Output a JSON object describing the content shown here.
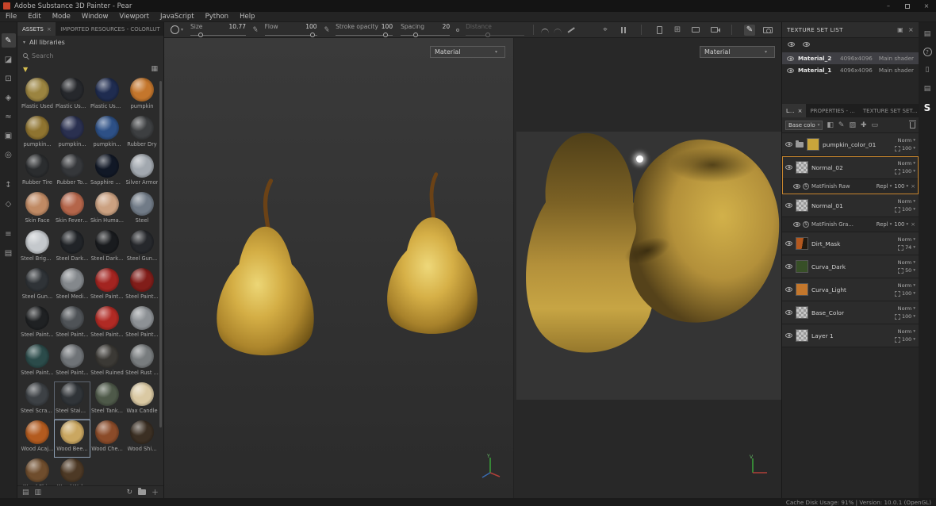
{
  "titlebar": {
    "title": "Adobe Substance 3D Painter - Pear"
  },
  "menubar": {
    "items": [
      "File",
      "Edit",
      "Mode",
      "Window",
      "Viewport",
      "JavaScript",
      "Python",
      "Help"
    ]
  },
  "toolbar": {
    "sliders": [
      {
        "label": "Size",
        "value": "10.77",
        "pct": 18
      },
      {
        "label": "Flow",
        "value": "100",
        "pct": 92
      },
      {
        "label": "Stroke opacity",
        "value": "100",
        "pct": 88
      },
      {
        "label": "Spacing",
        "value": "20",
        "pct": 30
      },
      {
        "label": "Distance",
        "value": "",
        "pct": 38,
        "disabled": true
      }
    ]
  },
  "tool_strip": {
    "groups": [
      [
        {
          "name": "paint-tool",
          "glyph": "✎",
          "active": true
        },
        {
          "name": "eraser-tool",
          "glyph": "◪"
        },
        {
          "name": "projection-tool",
          "glyph": "⊡"
        },
        {
          "name": "polygon-fill-tool",
          "glyph": "◈"
        },
        {
          "name": "smudge-tool",
          "glyph": "≈"
        },
        {
          "name": "clone-tool",
          "glyph": "▣"
        },
        {
          "name": "material-picker-tool",
          "glyph": "◎"
        }
      ],
      [
        {
          "name": "export-tool",
          "glyph": "↕"
        },
        {
          "name": "geometry-tool",
          "glyph": "◇"
        }
      ],
      [
        {
          "name": "settings-tool",
          "glyph": "≡"
        },
        {
          "name": "shelf-tool",
          "glyph": "▤"
        }
      ]
    ]
  },
  "assets_panel": {
    "tab_assets": "ASSETS",
    "tab_imported": "IMPORTED RESOURCES - COLORLUT",
    "all_libraries": "All libraries",
    "search_placeholder": "Search",
    "materials": [
      {
        "label": "Plastic Used",
        "color": "#9b8440"
      },
      {
        "label": "Plastic Use...",
        "color": "#26282c"
      },
      {
        "label": "Plastic Use...",
        "color": "#1f2c50"
      },
      {
        "label": "pumpkin",
        "color": "#c4762c"
      },
      {
        "label": "pumpkin...",
        "color": "#8f7430"
      },
      {
        "label": "pumpkin...",
        "color": "#2a3050"
      },
      {
        "label": "pumpkin...",
        "color": "#2d5086"
      },
      {
        "label": "Rubber Dry",
        "color": "#3d3f41"
      },
      {
        "label": "Rubber Tire",
        "color": "#2b2d2f"
      },
      {
        "label": "Rubber To...",
        "color": "#35373a"
      },
      {
        "label": "Sapphire C...",
        "color": "#111826"
      },
      {
        "label": "Silver Armor",
        "color": "#a2a8af"
      },
      {
        "label": "Skin Face",
        "color": "#c08a64"
      },
      {
        "label": "Skin Feverish",
        "color": "#b4654a"
      },
      {
        "label": "Skin Huma...",
        "color": "#cba181"
      },
      {
        "label": "Steel",
        "color": "#717b87"
      },
      {
        "label": "Steel Brigh...",
        "color": "#c4c8cc"
      },
      {
        "label": "Steel Dark...",
        "color": "#212428"
      },
      {
        "label": "Steel Dark...",
        "color": "#191b1e"
      },
      {
        "label": "Steel Gun...",
        "color": "#26282c"
      },
      {
        "label": "Steel Gun...",
        "color": "#2f3337"
      },
      {
        "label": "Steel Medi...",
        "color": "#84888c"
      },
      {
        "label": "Steel Painted",
        "color": "#a32420"
      },
      {
        "label": "Steel Paint...",
        "color": "#811d19"
      },
      {
        "label": "Steel Paint...",
        "color": "#1f2123"
      },
      {
        "label": "Steel Paint...",
        "color": "#4f5357"
      },
      {
        "label": "Steel Paint...",
        "color": "#b12a24"
      },
      {
        "label": "Steel Paint...",
        "color": "#8d9195"
      },
      {
        "label": "Steel Paint...",
        "color": "#2b4b4a"
      },
      {
        "label": "Steel Paint...",
        "color": "#6f7377"
      },
      {
        "label": "Steel Ruined",
        "color": "#3b3935"
      },
      {
        "label": "Steel Rust ...",
        "color": "#787c7e"
      },
      {
        "label": "Steel Scrat...",
        "color": "#3d4145"
      },
      {
        "label": "Steel Stained",
        "color": "#303438",
        "focused": true
      },
      {
        "label": "Steel Tank...",
        "color": "#4e5949"
      },
      {
        "label": "Wax Candle",
        "color": "#dac9a3"
      },
      {
        "label": "Wood Acaj...",
        "color": "#b35b1f"
      },
      {
        "label": "Wood Bee...",
        "color": "#caa761",
        "selected": true
      },
      {
        "label": "Wood Che...",
        "color": "#8b4b29"
      },
      {
        "label": "Wood Shi...",
        "color": "#3b2f23"
      },
      {
        "label": "Wood Shi...",
        "color": "#6f4d2d"
      },
      {
        "label": "Wood Wal...",
        "color": "#4d3925"
      }
    ]
  },
  "viewport3d": {
    "shading": "Material"
  },
  "viewport2d": {
    "shading": "Material"
  },
  "texture_set_list": {
    "title": "TEXTURE SET LIST",
    "rows": [
      {
        "name": "Material_2",
        "size": "4096x4096",
        "shader": "Main shader",
        "selected": true
      },
      {
        "name": "Material_1",
        "size": "4096x4096",
        "shader": "Main shader",
        "selected": false
      }
    ]
  },
  "layers_panel": {
    "tabs": [
      {
        "label": "L...",
        "close": true,
        "active": true
      },
      {
        "label": "PROPERTIES - ...",
        "close": false,
        "active": false
      },
      {
        "label": "TEXTURE SET SET...",
        "close": false,
        "active": false
      }
    ],
    "channel_dropdown": "Base colo",
    "toolbar_icons": [
      {
        "name": "add-mask-icon",
        "glyph": "◧"
      },
      {
        "name": "add-paint-icon",
        "glyph": "✎"
      },
      {
        "name": "add-fill-icon",
        "glyph": "▨"
      },
      {
        "name": "add-smart-material-icon",
        "glyph": "✚"
      },
      {
        "name": "add-folder-icon",
        "glyph": "▭"
      }
    ],
    "layers": [
      {
        "name": "pumpkin_color_01",
        "blend": "Norm",
        "opacity": "100",
        "thumb": "#c9a53b",
        "folder": true
      },
      {
        "name": "Normal_02",
        "blend": "Norm",
        "opacity": "100",
        "thumb": "checker",
        "selected": true,
        "sub": {
          "name": "MatFinish Raw",
          "blend": "Repl",
          "opacity": "100"
        }
      },
      {
        "name": "Normal_01",
        "blend": "Norm",
        "opacity": "100",
        "thumb": "checker",
        "sub": {
          "name": "MatFinish Gra...",
          "blend": "Repl",
          "opacity": "100"
        }
      },
      {
        "name": "Dirt_Mask",
        "blend": "Norm",
        "opacity": "74",
        "thumb": "#b4581e",
        "thumb2": "#221a10"
      },
      {
        "name": "Curva_Dark",
        "blend": "Norm",
        "opacity": "50",
        "thumb": "#374f27"
      },
      {
        "name": "Curva_Light",
        "blend": "Norm",
        "opacity": "100",
        "thumb": "#c4772c"
      },
      {
        "name": "Base_Color",
        "blend": "Norm",
        "opacity": "100",
        "thumb": "checker"
      },
      {
        "name": "Layer 1",
        "blend": "Norm",
        "opacity": "100",
        "thumb": "checker"
      }
    ]
  },
  "right_strip": {
    "icons": [
      {
        "name": "panel-toggle-icon",
        "glyph": "▤"
      },
      {
        "name": "help-icon",
        "glyph": "?",
        "cls": "help"
      },
      {
        "name": "document-icon",
        "glyph": "▯"
      },
      {
        "name": "list-icon",
        "glyph": "▤"
      },
      {
        "name": "substance-logo",
        "glyph": "S",
        "cls": "logo"
      }
    ]
  },
  "statusbar": {
    "text": "Cache Disk Usage:  91% | Version: 10.0.1 (OpenGL)"
  }
}
